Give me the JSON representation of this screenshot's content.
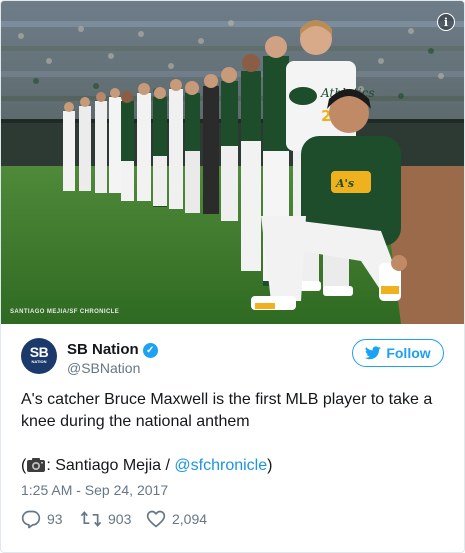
{
  "photo": {
    "credit": "SANTIAGO MEJIA/SF CHRONICLE",
    "jersey_text": "Athletics",
    "jersey_number": "20",
    "info_glyph": "i",
    "info_icon": "info-icon"
  },
  "account": {
    "avatar_text": "SB",
    "avatar_subtext": "NATION",
    "name": "SB Nation",
    "handle": "@SBNation",
    "verified_icon": "verified-badge-icon"
  },
  "follow": {
    "label": "Follow",
    "icon": "twitter-bird-icon"
  },
  "tweet": {
    "text": "A's catcher Bruce Maxwell is the first MLB player to take a knee during the national anthem",
    "credit_prefix": "(",
    "credit_name": ": Santiago Mejia / ",
    "credit_link": "@sfchronicle",
    "credit_suffix": ")",
    "credit_icon": "camera-icon"
  },
  "timestamp": "1:25 AM - Sep 24, 2017",
  "actions": {
    "replies": "93",
    "retweets": "903",
    "likes": "2,094"
  },
  "colors": {
    "accent": "#1da1f2",
    "link": "#1b95e0",
    "muted": "#657786",
    "athletics_green": "#1e4d2b",
    "athletics_gold": "#efb21e"
  }
}
